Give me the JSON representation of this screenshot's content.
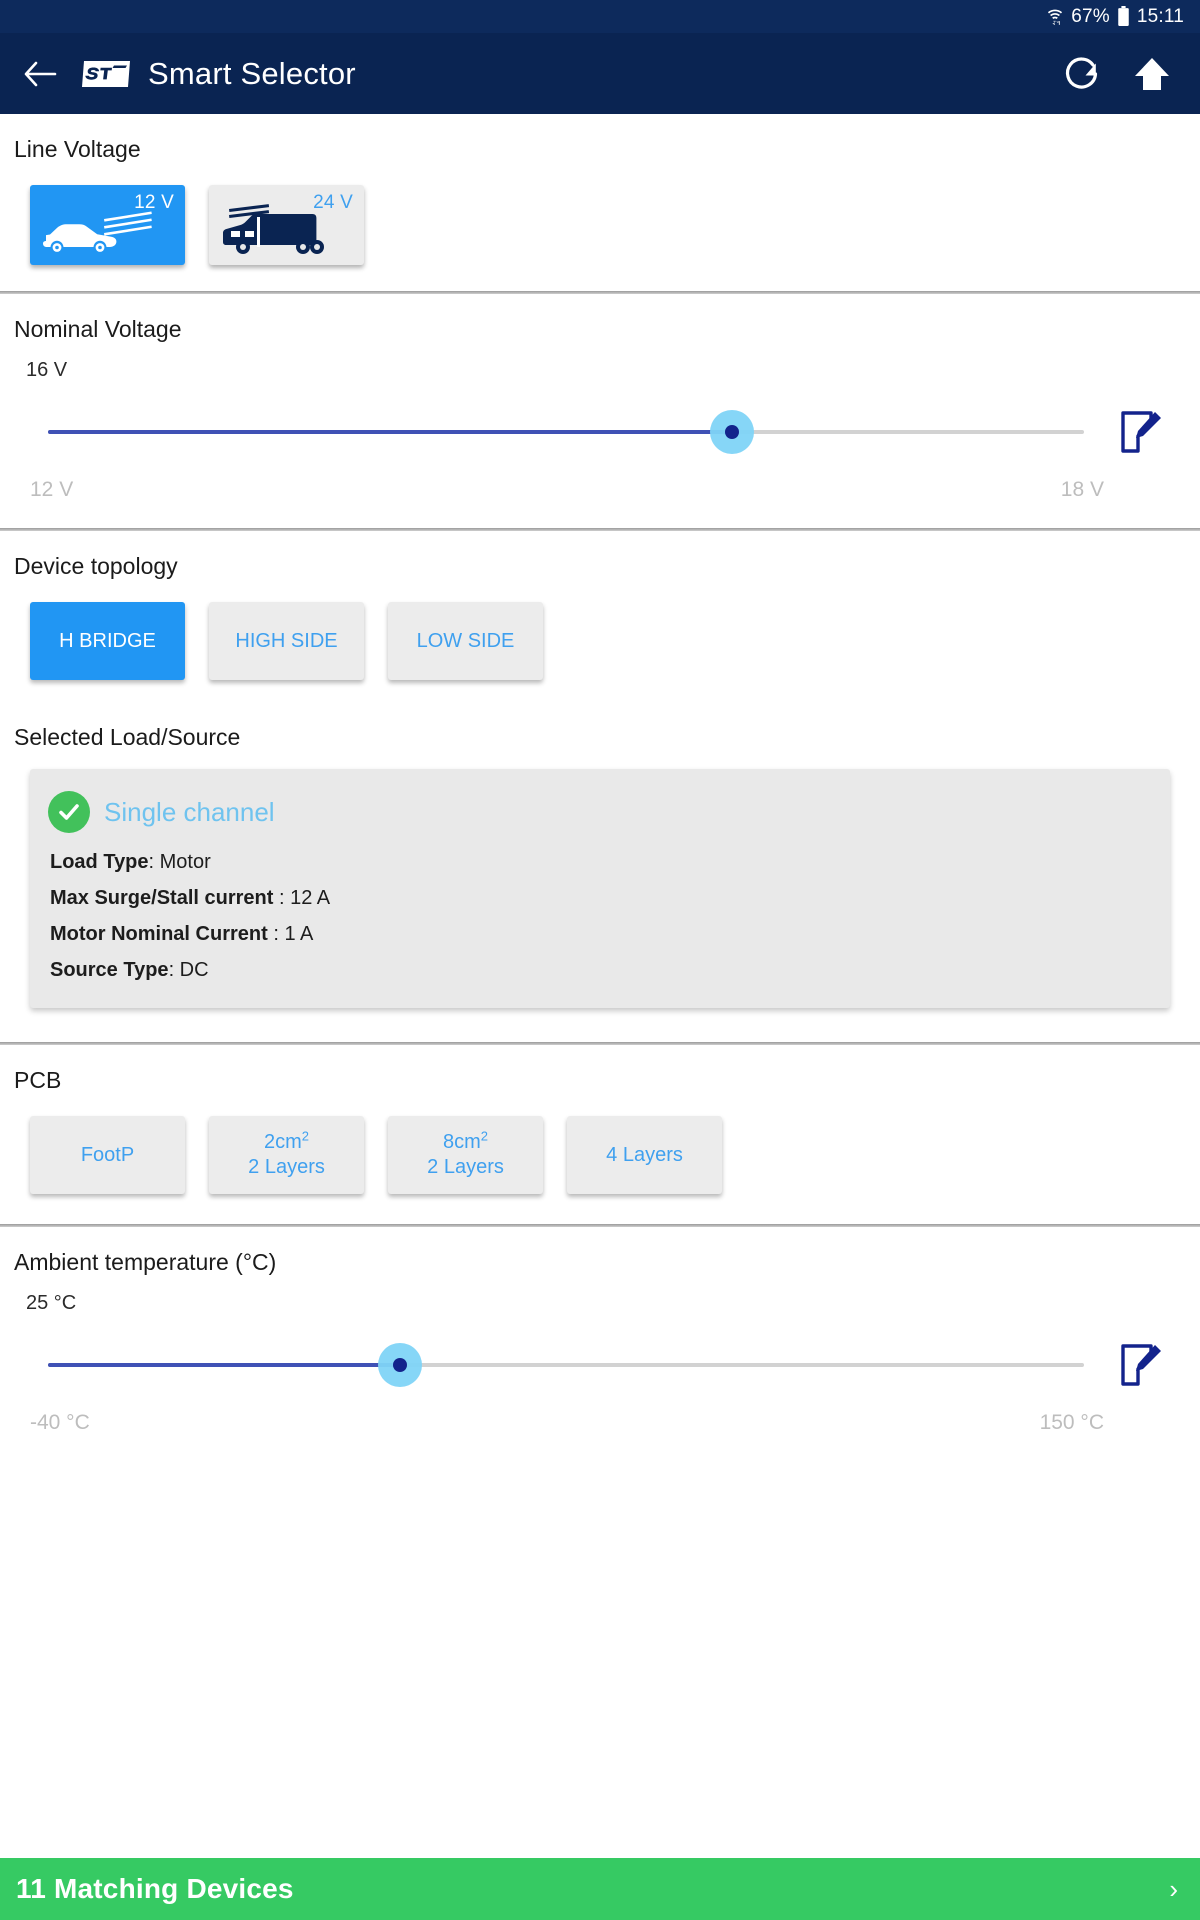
{
  "statusbar": {
    "wifi_icon": "wifi-icon",
    "battery_percent": "67%",
    "battery_icon": "battery-icon",
    "clock": "15:11"
  },
  "appbar": {
    "back_icon": "back-arrow-icon",
    "logo": "st-logo",
    "title": "Smart Selector",
    "refresh_icon": "refresh-icon",
    "home_icon": "home-icon"
  },
  "line_voltage": {
    "title": "Line Voltage",
    "options": [
      {
        "label": "12 V",
        "icon": "car-icon",
        "selected": true
      },
      {
        "label": "24 V",
        "icon": "truck-icon",
        "selected": false
      }
    ]
  },
  "nominal_voltage": {
    "title": "Nominal Voltage",
    "value": "16 V",
    "min_label": "12 V",
    "max_label": "18 V",
    "percent": 66,
    "edit_icon": "edit-pencil-icon"
  },
  "device_topology": {
    "title": "Device topology",
    "options": [
      {
        "label": "H BRIDGE",
        "selected": true
      },
      {
        "label": "HIGH SIDE",
        "selected": false
      },
      {
        "label": "LOW SIDE",
        "selected": false
      }
    ]
  },
  "selected_load": {
    "title": "Selected Load/Source",
    "check_icon": "check-circle-icon",
    "channel": "Single channel",
    "rows": [
      {
        "key": "Load Type",
        "value": ": Motor"
      },
      {
        "key": "Max Surge/Stall current",
        "value": " : 12 A"
      },
      {
        "key": "Motor Nominal Current",
        "value": " : 1 A"
      },
      {
        "key": "Source Type",
        "value": ": DC"
      }
    ]
  },
  "pcb": {
    "title": "PCB",
    "options": [
      {
        "line1": "FootP",
        "line2": "",
        "sup": "",
        "selected": false
      },
      {
        "line1": "2cm",
        "sup": "2",
        "line2": "2 Layers",
        "selected": false
      },
      {
        "line1": "8cm",
        "sup": "2",
        "line2": "2 Layers",
        "selected": false
      },
      {
        "line1": "4 Layers",
        "sup": "",
        "line2": "",
        "selected": false
      }
    ]
  },
  "ambient": {
    "title": "Ambient temperature (°C)",
    "value": "25 °C",
    "min_label": "-40 °C",
    "max_label": "150 °C",
    "percent": 34,
    "edit_icon": "edit-pencil-icon"
  },
  "bottom": {
    "label": "11 Matching Devices",
    "chevron": "›"
  },
  "colors": {
    "appbar": "#0a2452",
    "statusbar": "#0d2a5c",
    "accent_blue": "#2196f3",
    "link_blue": "#3fa0ef",
    "slider_fill": "#3f51b5",
    "thumb": "#13238c",
    "halo": "#7fd4f7",
    "green": "#36ca63",
    "check_green": "#42c15b"
  }
}
